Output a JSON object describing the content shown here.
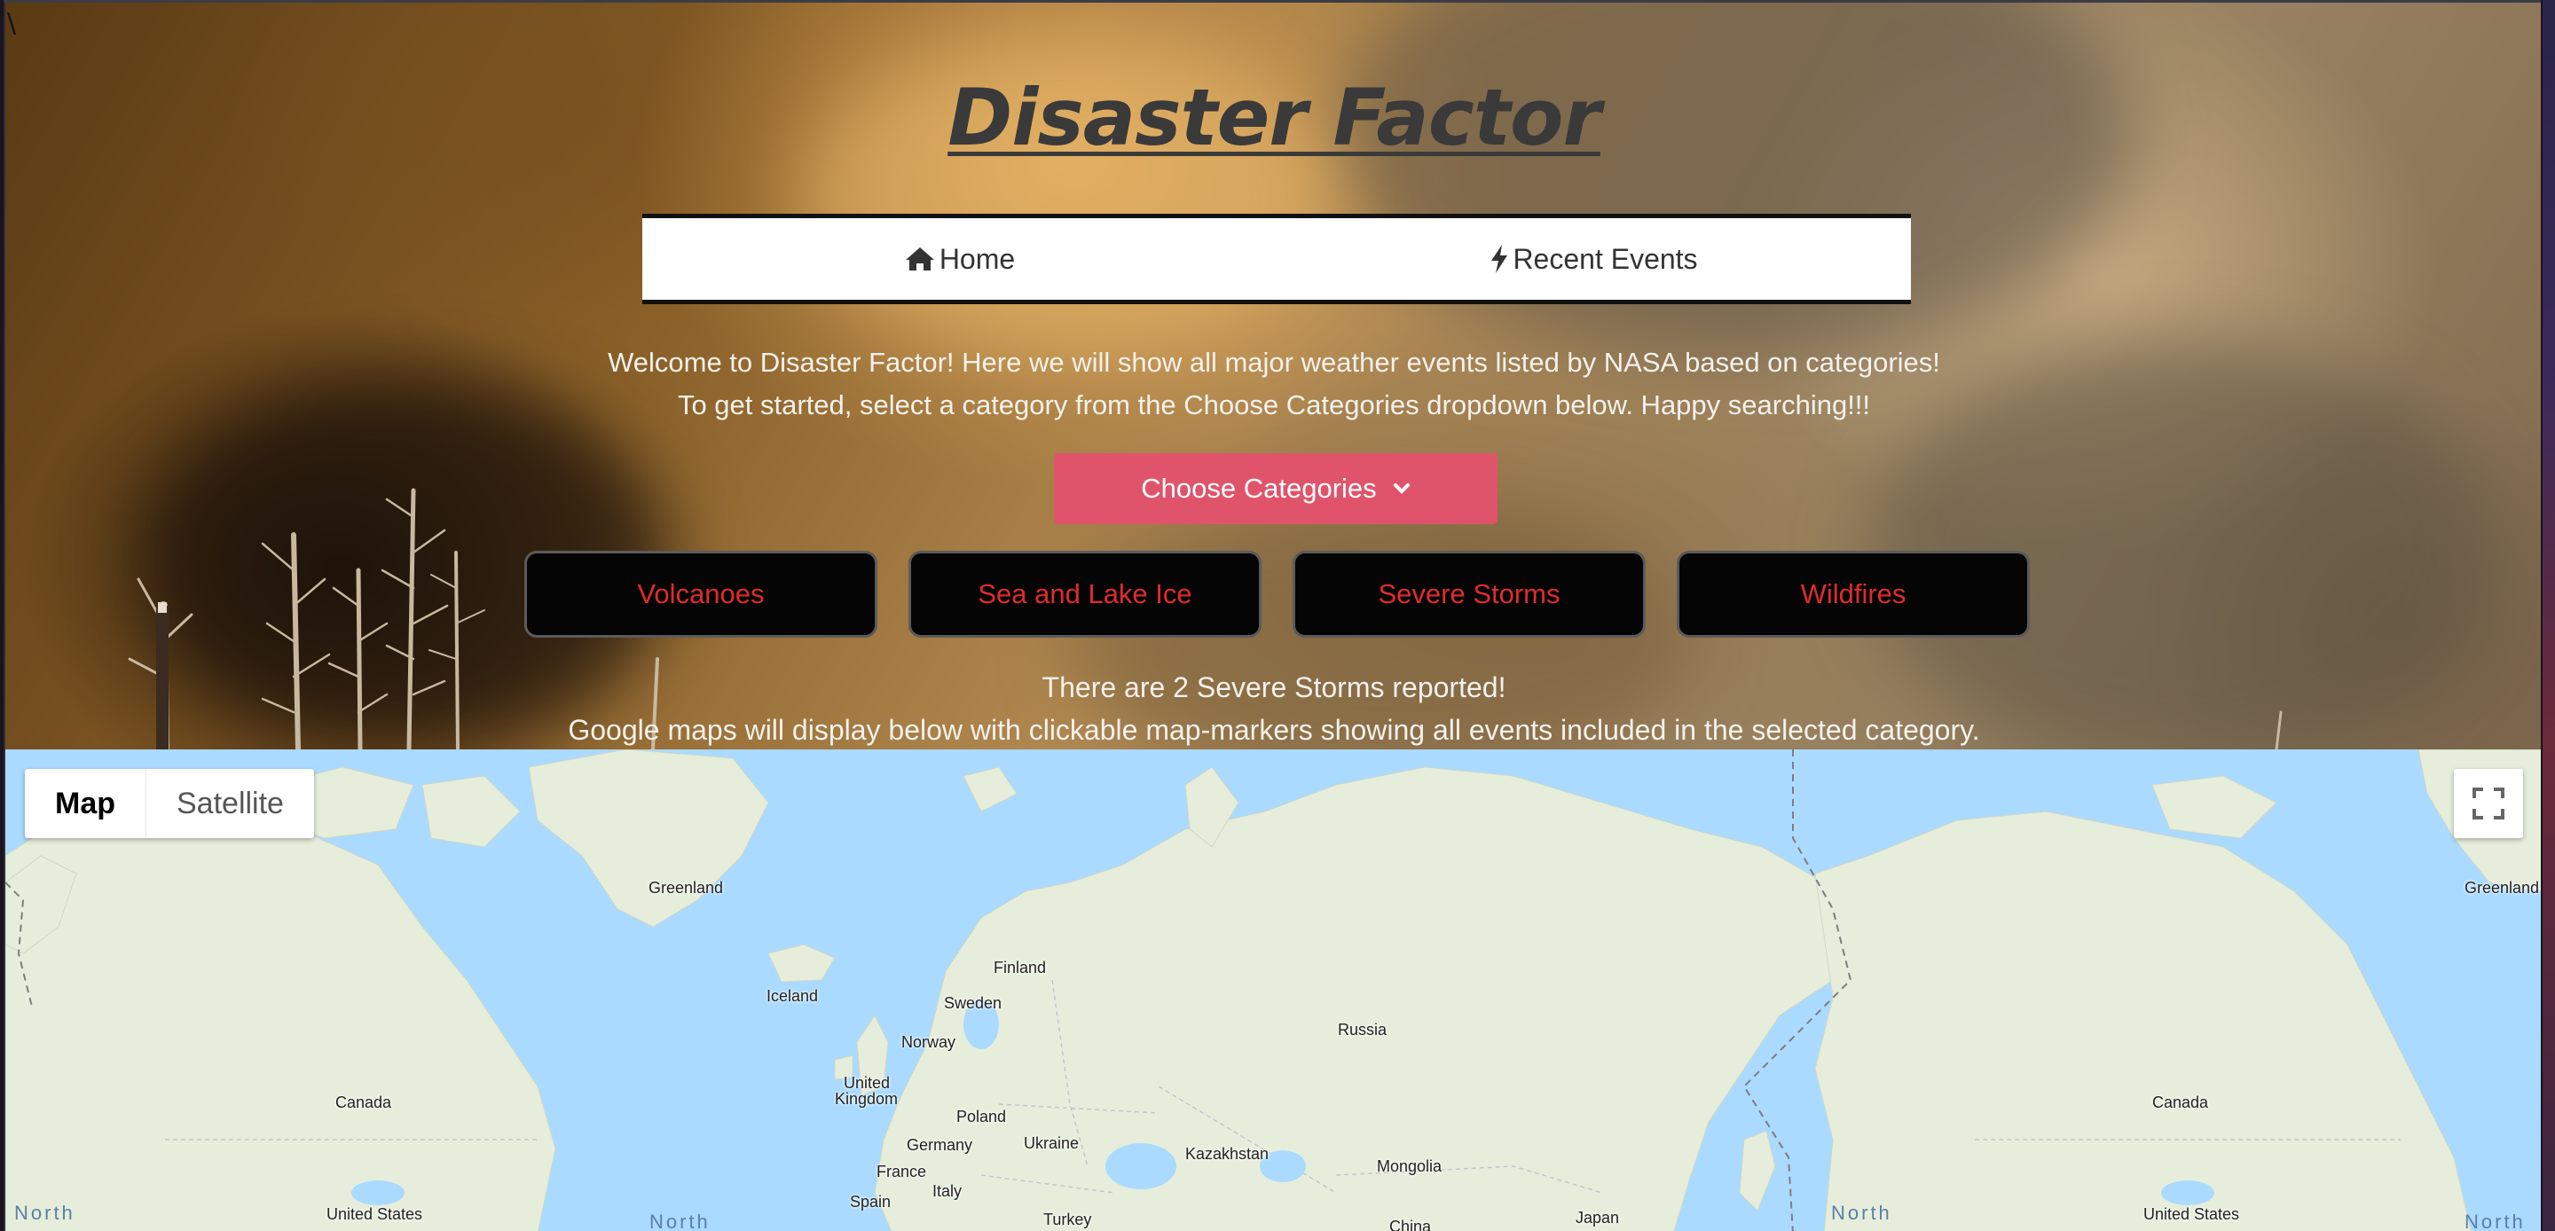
{
  "header": {
    "title": "Disaster Factor"
  },
  "nav": {
    "items": [
      {
        "label": "Home",
        "icon": "home-icon"
      },
      {
        "label": "Recent Events",
        "icon": "lightning-bolt-icon"
      }
    ]
  },
  "intro": {
    "line1": "Welcome to Disaster Factor! Here we will show all major weather events listed by NASA based on categories!",
    "line2": "To get started, select a category from the Choose Categories dropdown below. Happy searching!!!"
  },
  "dropdown": {
    "label": "Choose Categories",
    "icon": "chevron-down-icon",
    "color": "#e0546b"
  },
  "categories": [
    {
      "label": "Volcanoes"
    },
    {
      "label": "Sea and Lake Ice"
    },
    {
      "label": "Severe Storms"
    },
    {
      "label": "Wildfires"
    }
  ],
  "category_text_color": "#e12b2b",
  "report": {
    "line1": "There are 2 Severe Storms reported!",
    "line2": "Google maps will display below with clickable map-markers showing all events included in the selected category."
  },
  "map": {
    "type_control": {
      "map": "Map",
      "satellite": "Satellite",
      "selected": "Map"
    },
    "fullscreen_icon": "fullscreen-icon",
    "labels": {
      "greenland_left": "Greenland",
      "greenland_right": "Greenland",
      "iceland": "Iceland",
      "finland": "Finland",
      "sweden": "Sweden",
      "norway": "Norway",
      "russia": "Russia",
      "united_kingdom_1": "United",
      "united_kingdom_2": "Kingdom",
      "poland": "Poland",
      "germany": "Germany",
      "ukraine": "Ukraine",
      "france": "France",
      "italy": "Italy",
      "spain": "Spain",
      "turkey": "Turkey",
      "kazakhstan": "Kazakhstan",
      "mongolia": "Mongolia",
      "china": "China",
      "japan": "Japan",
      "canada_left": "Canada",
      "canada_right": "Canada",
      "us_left": "United States",
      "us_right": "United States",
      "north_1": "North",
      "north_2": "North",
      "north_3": "North",
      "north_4": "North"
    },
    "water_color": "#aadaff",
    "land_color": "#e8efdc"
  }
}
